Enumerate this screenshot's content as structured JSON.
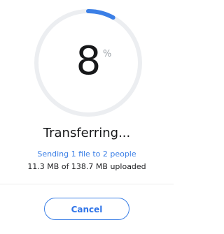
{
  "progress": {
    "value": 8,
    "unit": "%"
  },
  "status": {
    "title": "Transferring...",
    "subtitle": "Sending 1 file to 2 people",
    "detail": "11.3 MB of 138.7 MB uploaded"
  },
  "actions": {
    "cancel_label": "Cancel"
  },
  "colors": {
    "accent": "#3b7fe6",
    "track": "#eceef1"
  }
}
